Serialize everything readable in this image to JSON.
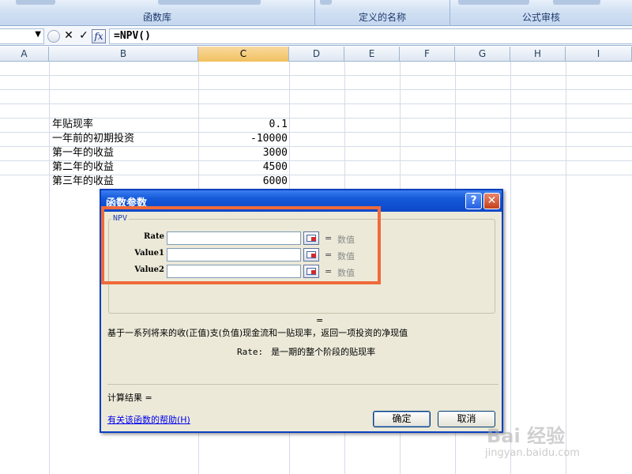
{
  "ribbon": {
    "groups": [
      "函数库",
      "定义的名称",
      "公式审核"
    ]
  },
  "formula_bar": {
    "name_box_arrow": "▼",
    "cancel_glyph": "✕",
    "enter_glyph": "✓",
    "fx_label": "fx",
    "formula": "=NPV()"
  },
  "columns": [
    {
      "label": "A",
      "selected": false
    },
    {
      "label": "B",
      "selected": false
    },
    {
      "label": "C",
      "selected": true
    },
    {
      "label": "D",
      "selected": false
    },
    {
      "label": "E",
      "selected": false
    },
    {
      "label": "F",
      "selected": false
    },
    {
      "label": "G",
      "selected": false
    },
    {
      "label": "H",
      "selected": false
    },
    {
      "label": "I",
      "selected": false
    }
  ],
  "sheet": {
    "rows": [
      {
        "label": "年贴现率",
        "value": "0.1"
      },
      {
        "label": "一年前的初期投资",
        "value": "-10000"
      },
      {
        "label": "第一年的收益",
        "value": "3000"
      },
      {
        "label": "第二年的收益",
        "value": "4500"
      },
      {
        "label": "第三年的收益",
        "value": "6000"
      }
    ]
  },
  "dialog": {
    "title": "函数参数",
    "help_glyph": "?",
    "close_glyph": "✕",
    "function_name": "NPV",
    "args": [
      {
        "name": "Rate",
        "value": "",
        "eq": "=",
        "hint": "数值"
      },
      {
        "name": "Value1",
        "value": "",
        "eq": "=",
        "hint": "数值"
      },
      {
        "name": "Value2",
        "value": "",
        "eq": "=",
        "hint": "数值"
      }
    ],
    "result_eq": "=",
    "description": "基于一系列将来的收(正值)支(负值)现金流和一贴现率，返回一项投资的净现值",
    "arg_desc_key": "Rate:",
    "arg_desc_text": "是一期的整个阶段的贴现率",
    "calc_result_label": "计算结果 =",
    "help_link": "有关该函数的帮助(H)",
    "ok_label": "确定",
    "cancel_label": "取消"
  },
  "watermark": {
    "brand": "Bai 经验",
    "url": "jingyan.baidu.com"
  },
  "colors": {
    "highlight": "#f06a3a",
    "title_bar": "#1458d8",
    "selected_column": "#f1c15f"
  }
}
